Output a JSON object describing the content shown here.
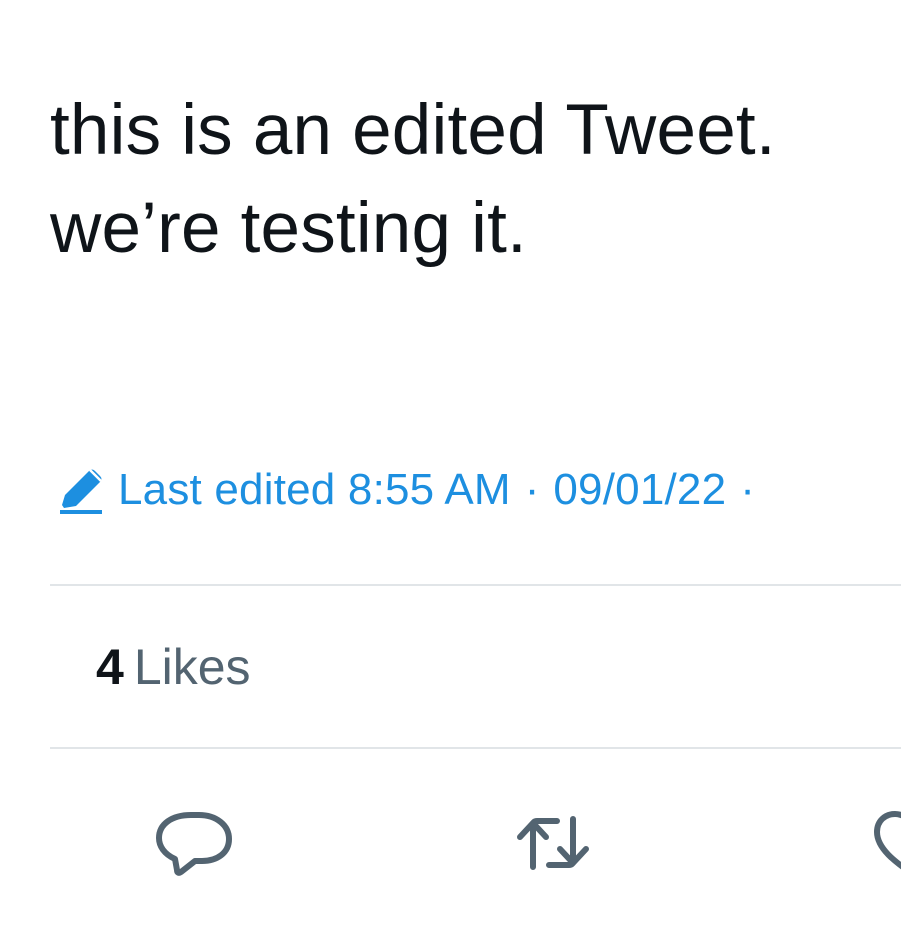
{
  "tweet": {
    "text_line_1": "this is an edited Tweet.",
    "text_line_2": "we’re testing it."
  },
  "edit_info": {
    "icon": "pencil-icon",
    "label": "Last edited 8:55 AM",
    "separator": "·",
    "date": "09/01/22",
    "trailing_separator": "·",
    "color": "#1d8fe0"
  },
  "engagement": {
    "likes_count": "4",
    "likes_label": "Likes"
  },
  "actions": [
    {
      "icon": "reply-icon"
    },
    {
      "icon": "retweet-icon"
    },
    {
      "icon": "like-icon"
    }
  ],
  "colors": {
    "text": "#0f1419",
    "secondary_text": "#536471",
    "accent": "#1d8fe0",
    "divider": "#e1e5e8"
  }
}
